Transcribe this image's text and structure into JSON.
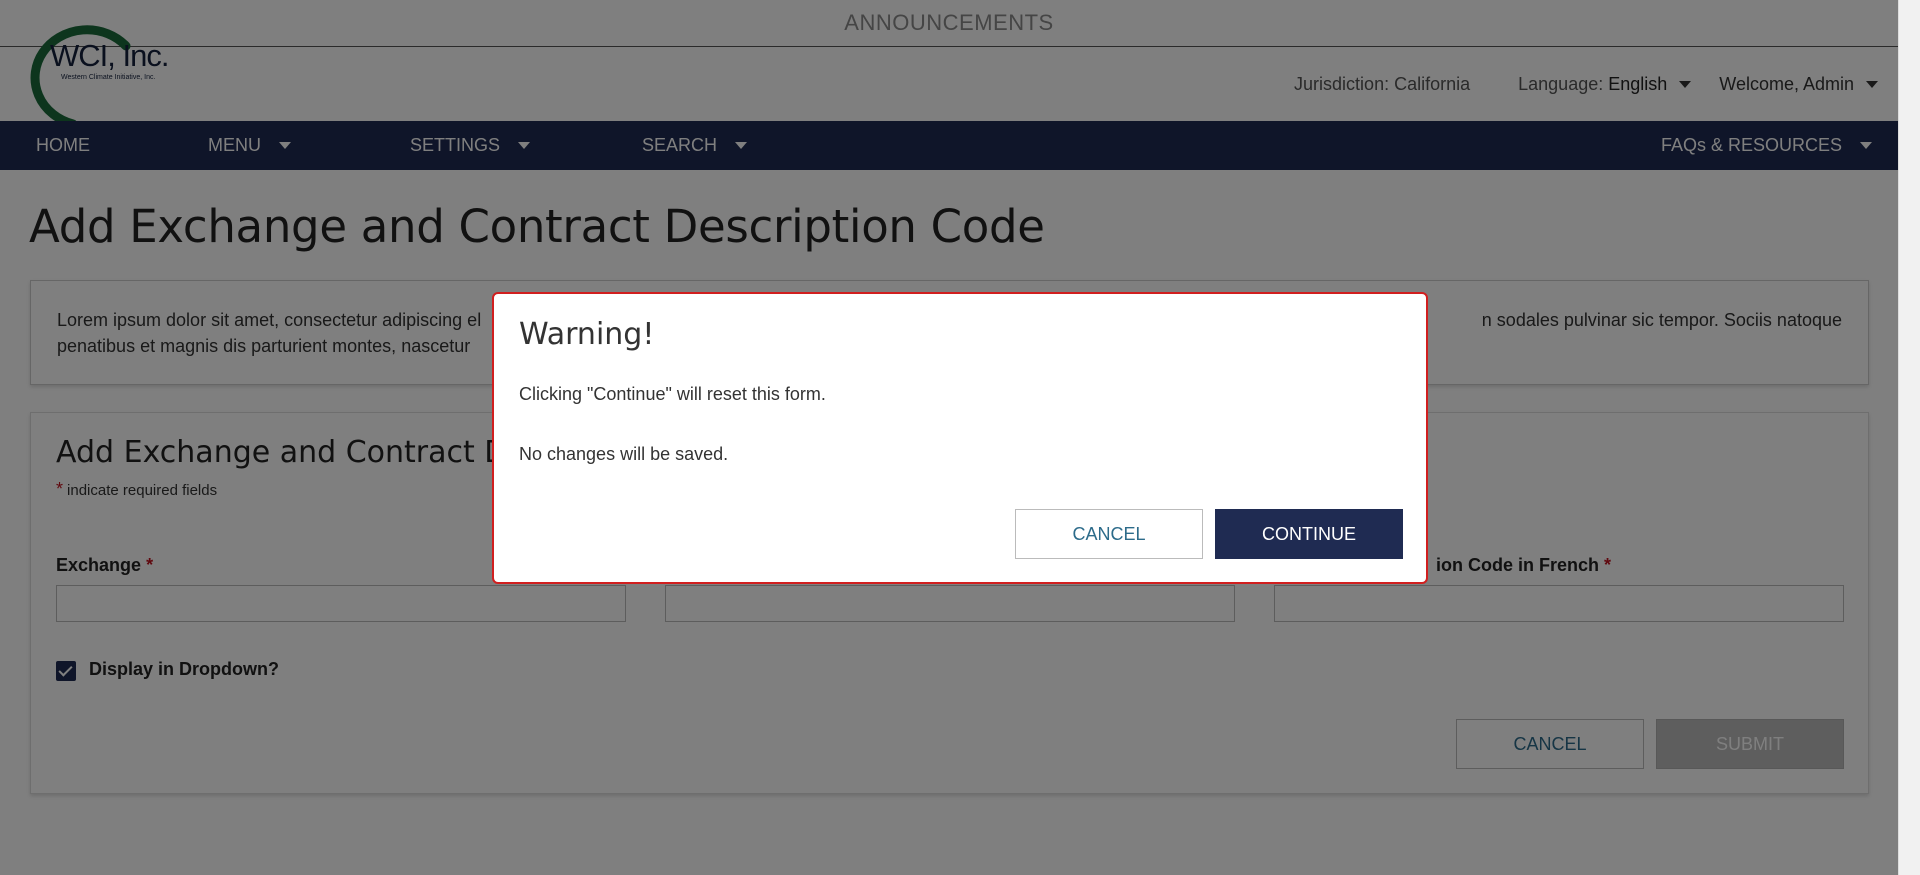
{
  "announcements": "ANNOUNCEMENTS",
  "logo": {
    "name": "WCI, Inc.",
    "tagline": "Western Climate Initiative, Inc."
  },
  "header": {
    "jurisdiction_label": "Jurisdiction:",
    "jurisdiction_value": "California",
    "language_label": "Language:",
    "language_value": "English",
    "welcome": "Welcome, Admin"
  },
  "nav": {
    "home": "HOME",
    "menu": "MENU",
    "settings": "SETTINGS",
    "search": "SEARCH",
    "faqs": "FAQs & RESOURCES"
  },
  "page_title": "Add Exchange and Contract Description Code",
  "description": "Lorem ipsum dolor sit amet, consectetur adipiscing el",
  "description_end": "n sodales pulvinar sic tempor. Sociis natoque",
  "description_line2": "penatibus et magnis dis parturient montes, nascetur",
  "form": {
    "title": "Add Exchange and Contract Desc",
    "required_note": "indicate required fields",
    "required_star": "*",
    "exchange_label": "Exchange",
    "french_label": "ion Code in French",
    "checkbox_label": "Display in Dropdown?",
    "cancel": "CANCEL",
    "submit": "SUBMIT"
  },
  "modal": {
    "title": "Warning!",
    "line1": "Clicking \"Continue\" will reset this form.",
    "line2": "No changes will be saved.",
    "cancel": "CANCEL",
    "continue": "CONTINUE"
  },
  "colors": {
    "navy": "#1f2b52",
    "warning_border": "#d11f1f",
    "link": "#2c6b8a",
    "logo_green": "#1a6b3a"
  }
}
